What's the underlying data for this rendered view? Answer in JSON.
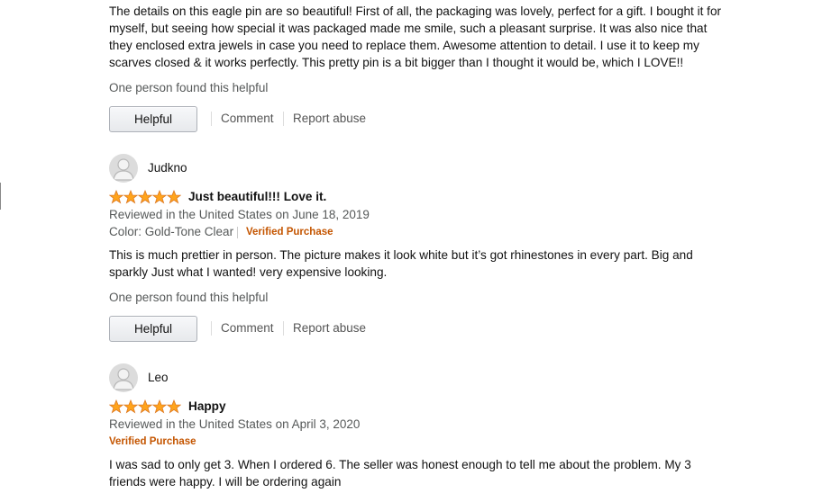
{
  "review_top": {
    "body": "The details on this eagle pin are so beautiful! First of all, the packaging was lovely, perfect for a gift. I bought it for myself, but seeing how special it was packaged made me smile, such a pleasant surprise. It was also nice that they enclosed extra jewels in case you need to replace them. Awesome attention to detail. I use it to keep my scarves closed & it works perfectly. This pretty pin is a bit bigger than I thought it would be, which I LOVE!!",
    "helpful_count": "One person found this helpful",
    "helpful_label": "Helpful",
    "comment_label": "Comment",
    "report_label": "Report abuse"
  },
  "review_judkno": {
    "reviewer": "Judkno",
    "rating": 5,
    "title": "Just beautiful!!! Love it.",
    "date": "Reviewed in the United States on June 18, 2019",
    "variant": "Color: Gold-Tone Clear",
    "verified": "Verified Purchase",
    "body": "This is much prettier in person. The picture makes it look white but it’s got rhinestones in every part. Big and sparkly Just what I wanted! very expensive looking.",
    "helpful_count": "One person found this helpful",
    "helpful_label": "Helpful",
    "comment_label": "Comment",
    "report_label": "Report abuse"
  },
  "review_leo": {
    "reviewer": "Leo",
    "rating": 5,
    "title": "Happy",
    "date": "Reviewed in the United States on April 3, 2020",
    "verified": "Verified Purchase",
    "body": "I was sad to only get 3. When I ordered 6. The seller was honest enough to tell me about the problem. My 3 friends were happy. I will be ordering again"
  },
  "colors": {
    "star": "#ffa41c",
    "star_stroke": "#de7921",
    "verified": "#c45500",
    "muted": "#565959"
  }
}
